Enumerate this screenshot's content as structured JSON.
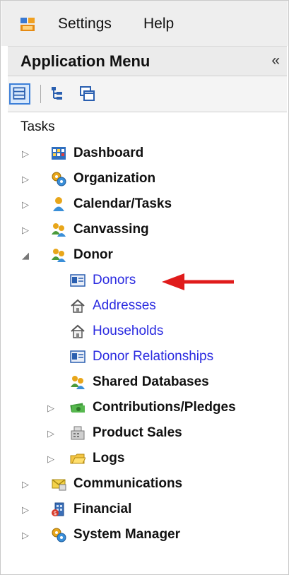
{
  "menubar": {
    "items": [
      {
        "label": "Settings"
      },
      {
        "label": "Help"
      }
    ]
  },
  "header": {
    "title": "Application Menu",
    "collapse_glyph": "«"
  },
  "toolbar": {
    "buttons": [
      "list-view-icon",
      "tree-view-icon",
      "window-view-icon"
    ]
  },
  "tasks_label": "Tasks",
  "tree": {
    "nodes": [
      {
        "label": "Dashboard",
        "icon": "dashboard-icon",
        "expander": "▷"
      },
      {
        "label": "Organization",
        "icon": "organization-icon",
        "expander": "▷"
      },
      {
        "label": "Calendar/Tasks",
        "icon": "calendar-icon",
        "expander": "▷"
      },
      {
        "label": "Canvassing",
        "icon": "canvassing-icon",
        "expander": "▷"
      },
      {
        "label": "Donor",
        "icon": "donor-icon",
        "expander": "◢"
      },
      {
        "label": "Donors",
        "icon": "card-icon"
      },
      {
        "label": "Addresses",
        "icon": "house-icon"
      },
      {
        "label": "Households",
        "icon": "house-icon"
      },
      {
        "label": "Donor Relationships",
        "icon": "card-icon"
      },
      {
        "label": "Shared Databases",
        "icon": "people-icon"
      },
      {
        "label": "Contributions/Pledges",
        "icon": "money-icon",
        "expander": "▷"
      },
      {
        "label": "Product Sales",
        "icon": "register-icon",
        "expander": "▷"
      },
      {
        "label": "Logs",
        "icon": "folder-icon",
        "expander": "▷"
      },
      {
        "label": "Communications",
        "icon": "communications-icon",
        "expander": "▷"
      },
      {
        "label": "Financial",
        "icon": "financial-icon",
        "expander": "▷"
      },
      {
        "label": "System Manager",
        "icon": "system-icon",
        "expander": "▷"
      }
    ]
  },
  "colors": {
    "link": "#2a2ae0",
    "arrow": "#e01b1b",
    "active_button": "#3c7fd8"
  }
}
